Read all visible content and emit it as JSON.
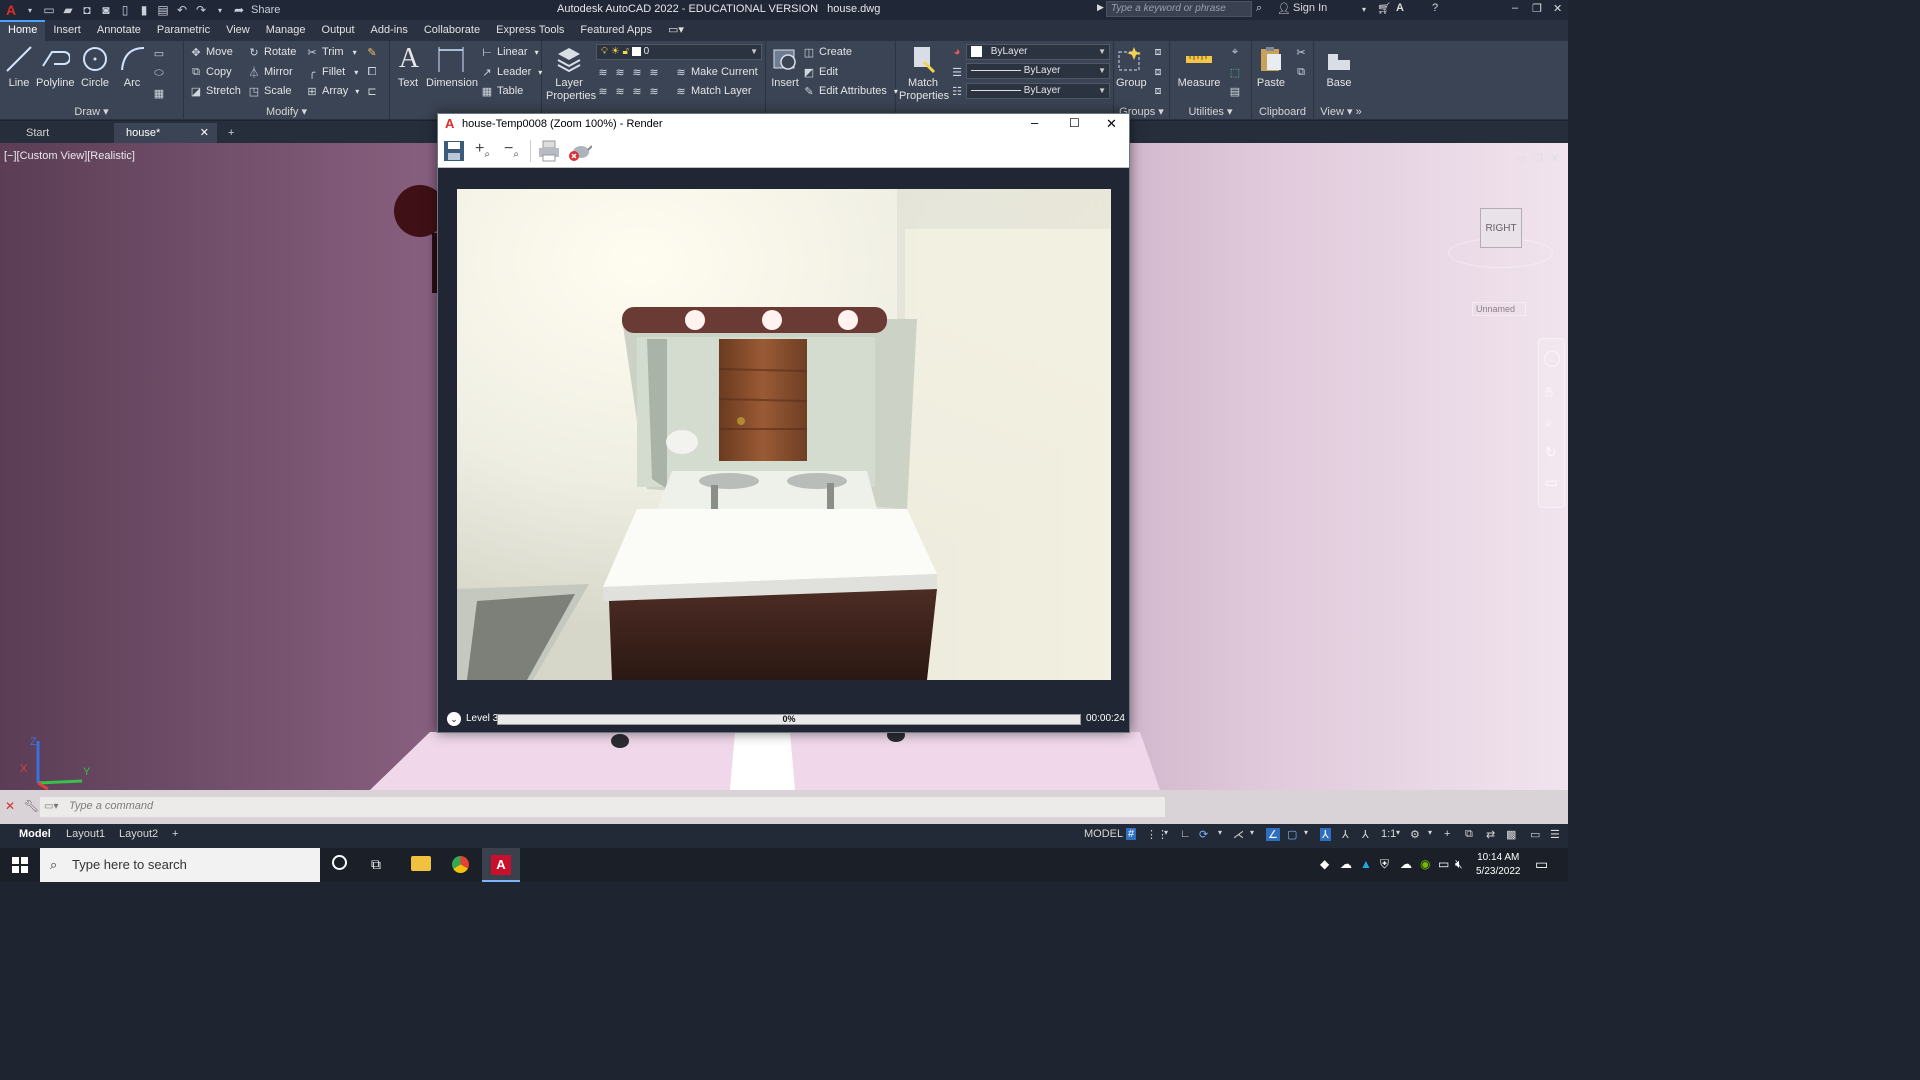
{
  "titlebar": {
    "share_label": "Share",
    "app_title": "Autodesk AutoCAD 2022 - EDUCATIONAL VERSION",
    "file_name": "house.dwg",
    "search_placeholder": "Type a keyword or phrase",
    "sign_in": "Sign In"
  },
  "ribbon_tabs": [
    "Home",
    "Insert",
    "Annotate",
    "Parametric",
    "View",
    "Manage",
    "Output",
    "Add-ins",
    "Collaborate",
    "Express Tools",
    "Featured Apps"
  ],
  "ribbon": {
    "draw": {
      "title": "Draw",
      "line": "Line",
      "polyline": "Polyline",
      "circle": "Circle",
      "arc": "Arc"
    },
    "modify": {
      "title": "Modify",
      "move": "Move",
      "rotate": "Rotate",
      "trim": "Trim",
      "copy": "Copy",
      "mirror": "Mirror",
      "fillet": "Fillet",
      "stretch": "Stretch",
      "scale": "Scale",
      "array": "Array"
    },
    "annotation": {
      "text": "Text",
      "dimension": "Dimension",
      "linear": "Linear",
      "leader": "Leader",
      "table": "Table"
    },
    "layers": {
      "layer_properties": "Layer Properties",
      "current_layer": "0",
      "make_current": "Make Current",
      "match_layer": "Match Layer"
    },
    "block": {
      "insert": "Insert",
      "create": "Create",
      "edit": "Edit",
      "edit_attributes": "Edit Attributes"
    },
    "properties": {
      "match_properties": "Match Properties",
      "color": "ByLayer",
      "linetype": "ByLayer",
      "lineweight": "ByLayer"
    },
    "groups": {
      "title": "Groups",
      "group": "Group"
    },
    "utilities": {
      "title": "Utilities",
      "measure": "Measure"
    },
    "clipboard": {
      "title": "Clipboard",
      "paste": "Paste"
    },
    "view": {
      "title": "View",
      "base": "Base"
    }
  },
  "doc_tabs": {
    "start": "Start",
    "house": "house*"
  },
  "viewport": {
    "label": "[−][Custom View][Realistic]",
    "viewcube_face": "RIGHT",
    "named_view": "Unnamed",
    "axis_x": "X",
    "axis_y": "Y",
    "axis_z": "Z"
  },
  "render_window": {
    "title": "house-Temp0008 (Zoom 100%) - Render",
    "level": "Level 3",
    "progress_text": "0%",
    "progress_value": 0.0,
    "elapsed": "00:00:24"
  },
  "command": {
    "placeholder": "Type a command"
  },
  "layout_tabs": [
    "Model",
    "Layout1",
    "Layout2"
  ],
  "status": {
    "model": "MODEL",
    "scale": "1:1"
  },
  "taskbar": {
    "search": "Type here to search",
    "time": "10:14 AM",
    "date": "5/23/2022"
  },
  "colors": {
    "accent": "#47a3ff",
    "ribbon_bg": "#3b4454",
    "autocad_red": "#e02b2b"
  }
}
